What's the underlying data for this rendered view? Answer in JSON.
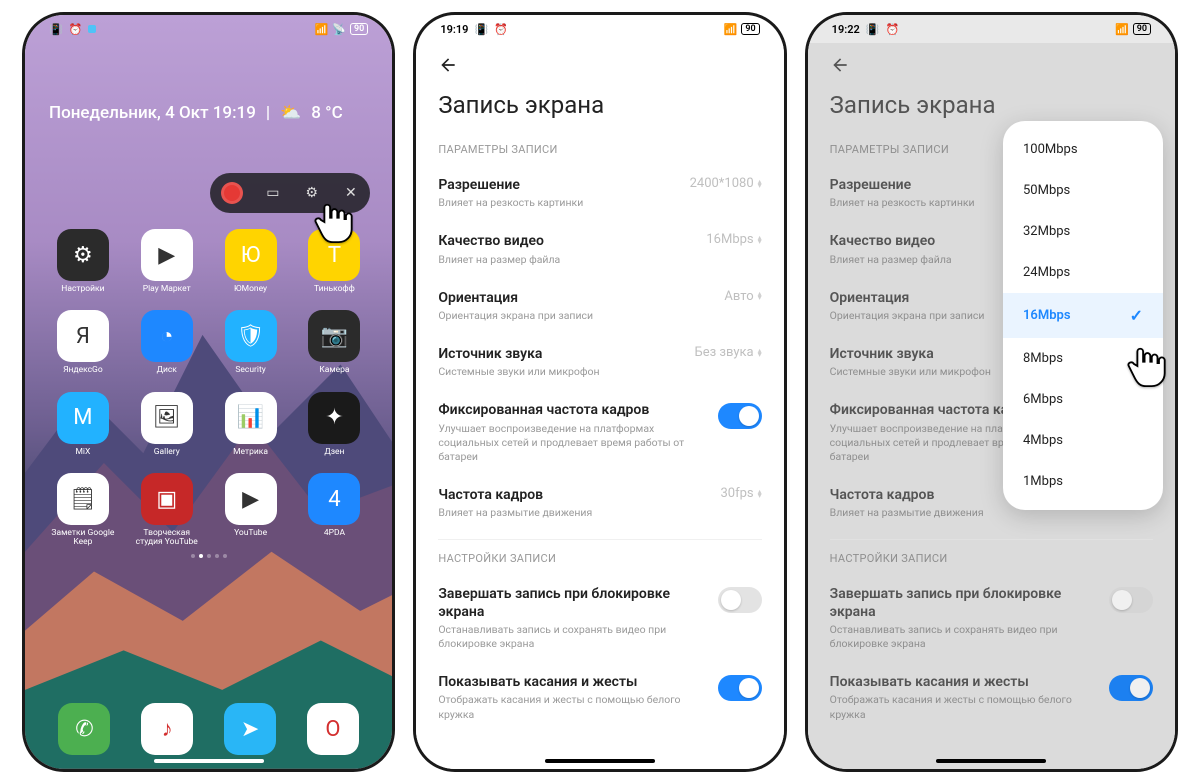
{
  "p1": {
    "statusbar": {
      "time": "",
      "battery": "90"
    },
    "dateweather": "Понедельник, 4 Окт  19:19",
    "temp": "8 °С",
    "apps_row1": [
      {
        "label": "Настройки",
        "bg": "#2b2b2b",
        "emoji": "⚙"
      },
      {
        "label": "Play Маркет",
        "bg": "#fff",
        "emoji": "▶"
      },
      {
        "label": "ЮMoney",
        "bg": "#ffd400",
        "emoji": "Ю"
      },
      {
        "label": "Тинькофф",
        "bg": "#ffd400",
        "emoji": "Т"
      }
    ],
    "apps_row2": [
      {
        "label": "ЯндексGo",
        "bg": "#fff",
        "emoji": "Я"
      },
      {
        "label": "Диск",
        "bg": "#1e88ff",
        "emoji": "◔"
      },
      {
        "label": "Security",
        "bg": "#22b2ff",
        "emoji": "🛡"
      },
      {
        "label": "Камера",
        "bg": "#2b2b2b",
        "emoji": "📷"
      }
    ],
    "apps_row3": [
      {
        "label": "MiX",
        "bg": "#22b2ff",
        "emoji": "M"
      },
      {
        "label": "Gallery",
        "bg": "#fff",
        "emoji": "🖼"
      },
      {
        "label": "Метрика",
        "bg": "#fff",
        "emoji": "📊"
      },
      {
        "label": "Дзен",
        "bg": "#1a1a1a",
        "emoji": "✦"
      }
    ],
    "apps_row4": [
      {
        "label": "Заметки Google Keep",
        "bg": "#fff",
        "emoji": "🗒"
      },
      {
        "label": "Творческая студия YouTube",
        "bg": "#c62828",
        "emoji": "▣"
      },
      {
        "label": "YouTube",
        "bg": "#fff",
        "emoji": "▶"
      },
      {
        "label": "4PDA",
        "bg": "#1e88ff",
        "emoji": "4"
      }
    ],
    "dock": [
      {
        "label": "Phone",
        "bg": "#4caf50",
        "emoji": "✆"
      },
      {
        "label": "Music",
        "bg": "#fff",
        "emoji": "♪"
      },
      {
        "label": "Telegram",
        "bg": "#29b6f6",
        "emoji": "➤"
      },
      {
        "label": "Opera",
        "bg": "#fff",
        "emoji": "O"
      }
    ]
  },
  "p2": {
    "statusbar": {
      "time": "19:19",
      "battery": "90"
    },
    "title": "Запись экрана",
    "section1": "ПАРАМЕТРЫ ЗАПИСИ",
    "rows": [
      {
        "t": "Разрешение",
        "s": "Влияет на резкость картинки",
        "v": "2400*1080"
      },
      {
        "t": "Качество видео",
        "s": "Влияет на размер файла",
        "v": "16Mbps"
      },
      {
        "t": "Ориентация",
        "s": "Ориентация экрана при записи",
        "v": "Авто"
      },
      {
        "t": "Источник звука",
        "s": "Системные звуки или микрофон",
        "v": "Без звука"
      }
    ],
    "toggle1": {
      "t": "Фиксированная частота кадров",
      "s": "Улучшает воспроизведение на платформах социальных сетей и продлевает время работы от батареи",
      "on": true
    },
    "framerate": {
      "t": "Частота кадров",
      "s": "Влияет на размытие движения",
      "v": "30fps"
    },
    "section2": "НАСТРОЙКИ ЗАПИСИ",
    "toggle2": {
      "t": "Завершать запись при блокировке экрана",
      "s": "Останавливать запись и сохранять видео при блокировке экрана",
      "on": false
    },
    "toggle3": {
      "t": "Показывать касания и жесты",
      "s": "Отображать касания и жесты с помощью белого кружка",
      "on": true
    }
  },
  "p3": {
    "statusbar": {
      "time": "19:22",
      "battery": "90"
    },
    "title": "Запись экрана",
    "popup_options": [
      "100Mbps",
      "50Mbps",
      "32Mbps",
      "24Mbps",
      "16Mbps",
      "8Mbps",
      "6Mbps",
      "4Mbps",
      "1Mbps"
    ],
    "popup_selected": "16Mbps"
  }
}
